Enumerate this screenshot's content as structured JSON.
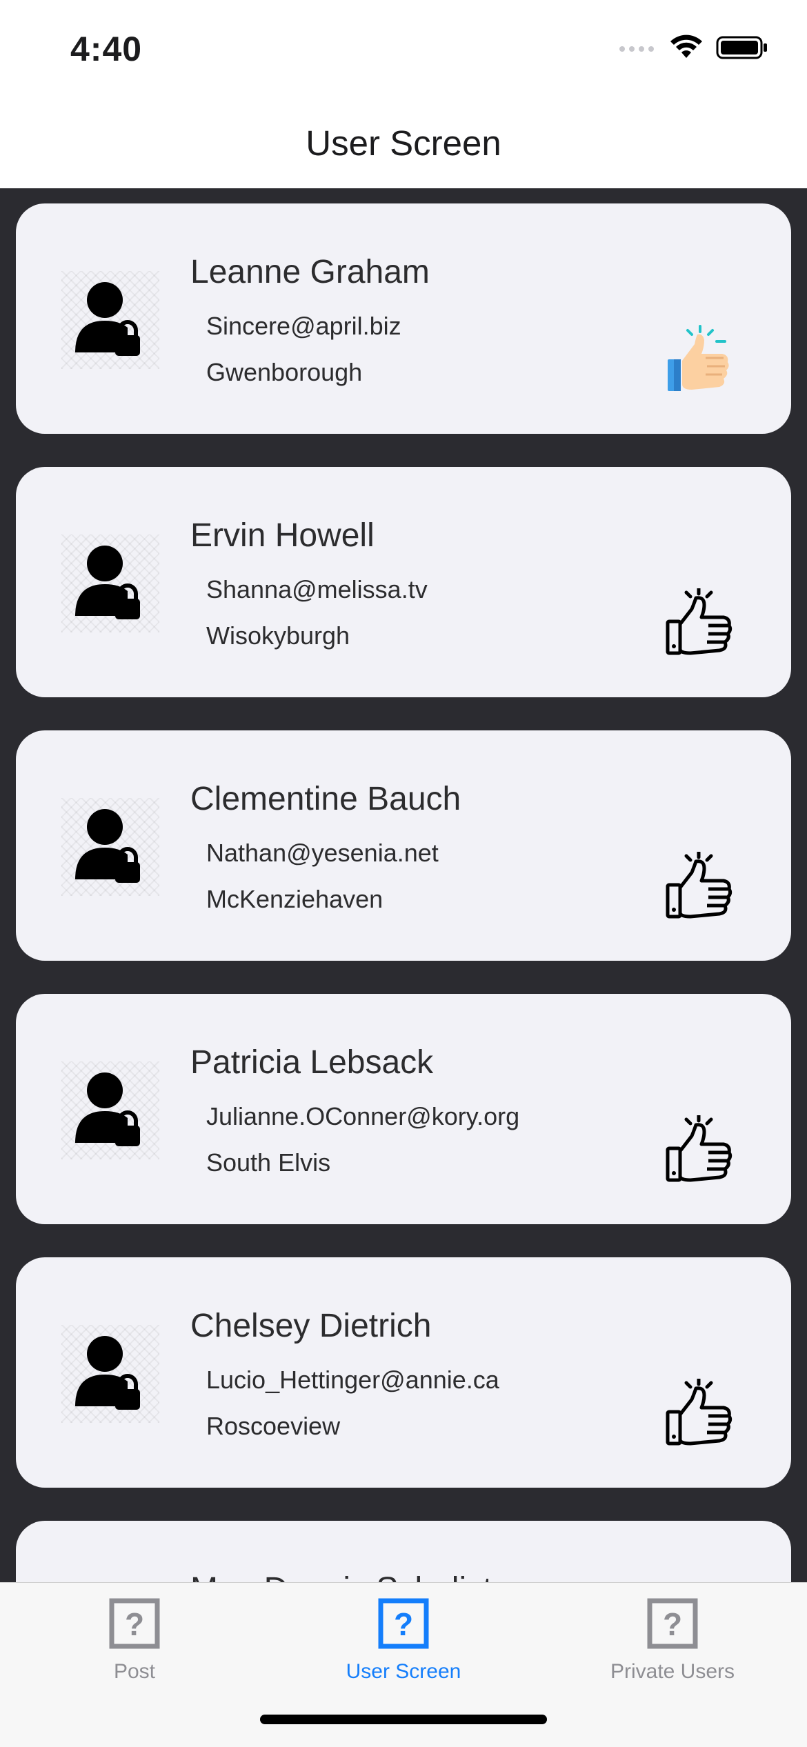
{
  "status_bar": {
    "time": "4:40"
  },
  "header": {
    "title": "User Screen"
  },
  "users": [
    {
      "name": "Leanne Graham",
      "email": "Sincere@april.biz",
      "city": "Gwenborough",
      "liked": true
    },
    {
      "name": "Ervin Howell",
      "email": "Shanna@melissa.tv",
      "city": "Wisokyburgh",
      "liked": false
    },
    {
      "name": "Clementine Bauch",
      "email": "Nathan@yesenia.net",
      "city": "McKenziehaven",
      "liked": false
    },
    {
      "name": "Patricia Lebsack",
      "email": "Julianne.OConner@kory.org",
      "city": "South Elvis",
      "liked": false
    },
    {
      "name": "Chelsey Dietrich",
      "email": "Lucio_Hettinger@annie.ca",
      "city": "Roscoeview",
      "liked": false
    },
    {
      "name": "Mrs. Dennis Schulist",
      "email": "",
      "city": "",
      "liked": false
    }
  ],
  "tabs": [
    {
      "label": "Post",
      "icon": "question-mark-icon",
      "active": false
    },
    {
      "label": "User Screen",
      "icon": "question-mark-icon",
      "active": true
    },
    {
      "label": "Private Users",
      "icon": "question-mark-icon",
      "active": false
    }
  ],
  "colors": {
    "accent": "#147efb",
    "inactive": "#8e8e93",
    "card": "#f2f2f7",
    "list_background": "#2b2b30"
  }
}
